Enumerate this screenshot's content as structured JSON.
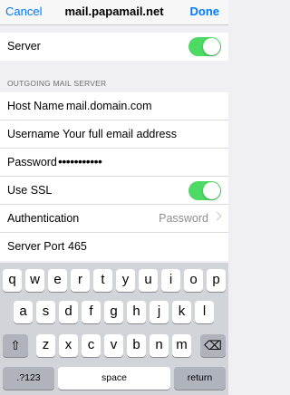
{
  "nav": {
    "cancel_label": "Cancel",
    "title": "mail.papamail.net",
    "done_label": "Done"
  },
  "server_row": {
    "label": "Server",
    "toggle_on": true
  },
  "outgoing": {
    "header": "OUTGOING MAIL SERVER",
    "host_name": {
      "label": "Host Name",
      "value": "mail.domain.com"
    },
    "username": {
      "label": "Username",
      "value": "Your full email address"
    },
    "password": {
      "label": "Password",
      "value": "•••••••••••"
    },
    "use_ssl": {
      "label": "Use SSL",
      "toggle_on": true
    },
    "authentication": {
      "label": "Authentication",
      "value": "Password"
    },
    "server_port": {
      "label": "Server Port",
      "value": "465"
    }
  },
  "keyboard": {
    "row1": [
      "q",
      "w",
      "e",
      "r",
      "t",
      "y",
      "u",
      "i",
      "o",
      "p"
    ],
    "row2": [
      "a",
      "s",
      "d",
      "f",
      "g",
      "h",
      "j",
      "k",
      "l"
    ],
    "row3": [
      "z",
      "x",
      "c",
      "v",
      "b",
      "n",
      "m"
    ],
    "shift_icon": "⇧",
    "delete_icon": "⌫",
    "numbers_label": ".?123",
    "space_label": "space",
    "return_label": "return"
  },
  "colors": {
    "accent": "#007aff",
    "toggle_on": "#4cd964",
    "background": "#efeff4"
  },
  "icons": {
    "chevron": "chevron-right-icon"
  }
}
